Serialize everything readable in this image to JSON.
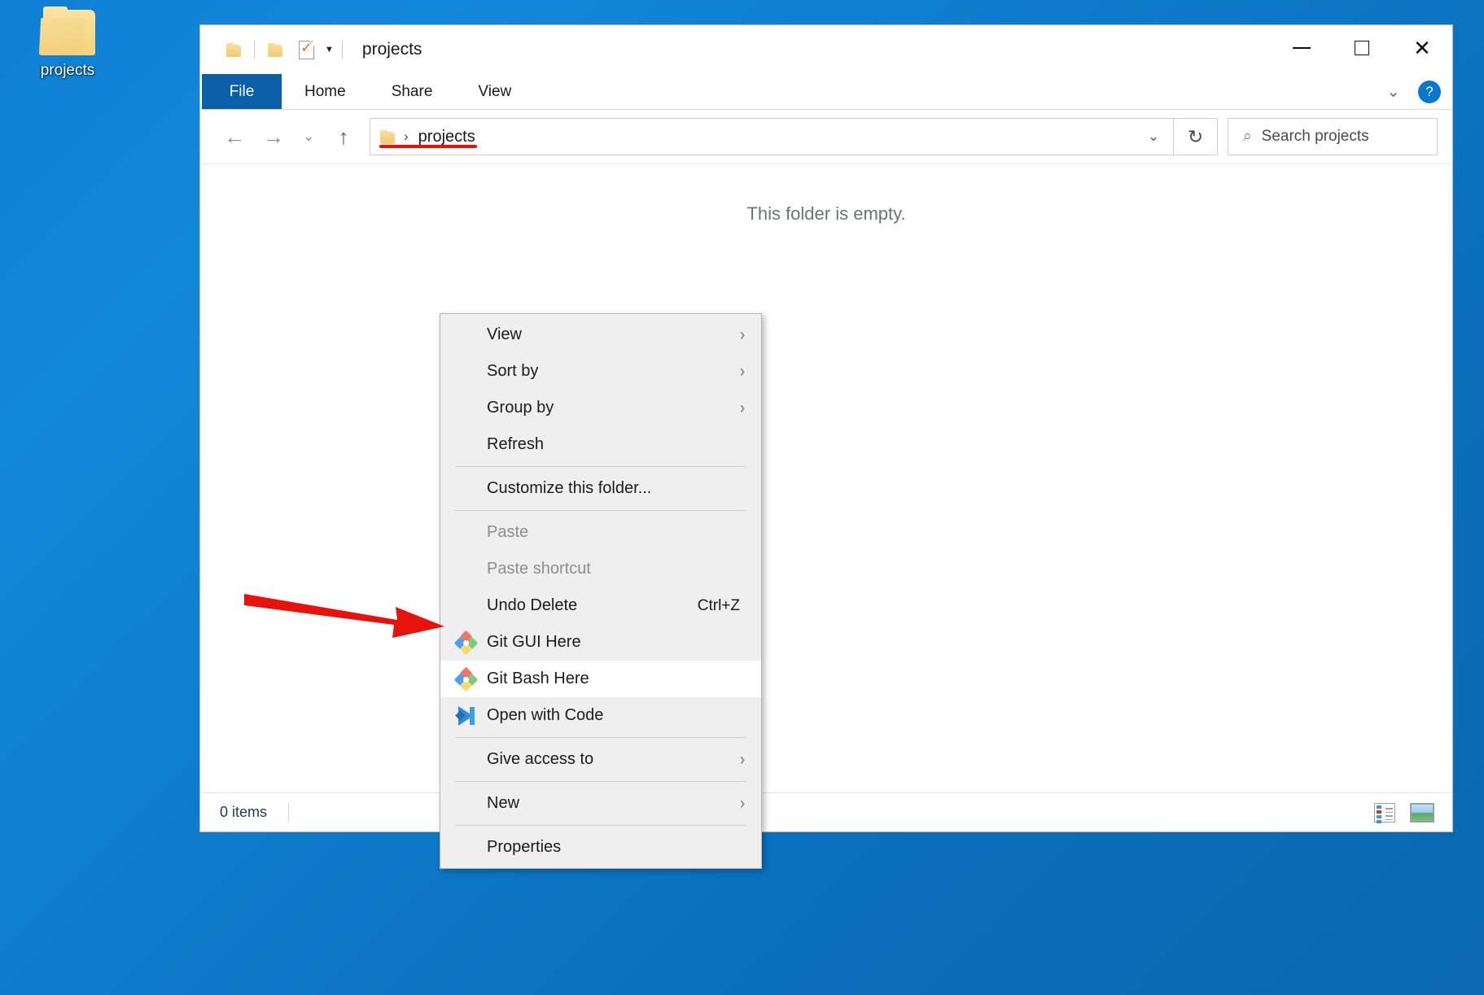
{
  "desktop": {
    "icon_label": "projects",
    "icon_name": "folder-icon"
  },
  "window": {
    "title": "projects",
    "quick_access": [
      "folder-icon",
      "folder-icon",
      "properties-checkbox-icon",
      "customize-caret-icon"
    ],
    "controls": {
      "minimize": "minimize-icon",
      "maximize": "maximize-icon",
      "close": "close-icon"
    },
    "ribbon": {
      "tabs": [
        "File",
        "Home",
        "Share",
        "View"
      ],
      "expand_label": "chevron-down-icon",
      "help_label": "?"
    },
    "address": {
      "back": "back-arrow-icon",
      "forward": "forward-arrow-icon",
      "recent": "recent-caret-icon",
      "up": "up-arrow-icon",
      "crumb": "projects",
      "separator": "›",
      "dropdown": "address-caret-icon",
      "refresh": "↻"
    },
    "search": {
      "placeholder": "Search projects",
      "icon": "search-icon"
    },
    "content": {
      "empty_message": "This folder is empty."
    },
    "status": {
      "count": "0 items",
      "view_details_icon": "details-view-icon",
      "view_thumbnails_icon": "thumbnail-view-icon"
    }
  },
  "context_menu": {
    "items": [
      {
        "label": "View",
        "type": "submenu",
        "icon": null,
        "accel": "",
        "state": "normal"
      },
      {
        "label": "Sort by",
        "type": "submenu",
        "icon": null,
        "accel": "",
        "state": "normal"
      },
      {
        "label": "Group by",
        "type": "submenu",
        "icon": null,
        "accel": "",
        "state": "normal"
      },
      {
        "label": "Refresh",
        "type": "item",
        "icon": null,
        "accel": "",
        "state": "normal"
      },
      {
        "label": "Customize this folder...",
        "type": "item",
        "icon": null,
        "accel": "",
        "state": "normal"
      },
      {
        "label": "Paste",
        "type": "item",
        "icon": null,
        "accel": "",
        "state": "disabled"
      },
      {
        "label": "Paste shortcut",
        "type": "item",
        "icon": null,
        "accel": "",
        "state": "disabled"
      },
      {
        "label": "Undo Delete",
        "type": "item",
        "icon": null,
        "accel": "Ctrl+Z",
        "state": "normal"
      },
      {
        "label": "Git GUI Here",
        "type": "item",
        "icon": "git-icon",
        "accel": "",
        "state": "normal"
      },
      {
        "label": "Git Bash Here",
        "type": "item",
        "icon": "git-icon",
        "accel": "",
        "state": "hover"
      },
      {
        "label": "Open with Code",
        "type": "item",
        "icon": "vscode-icon",
        "accel": "",
        "state": "normal"
      },
      {
        "label": "Give access to",
        "type": "submenu",
        "icon": null,
        "accel": "",
        "state": "normal"
      },
      {
        "label": "New",
        "type": "submenu",
        "icon": null,
        "accel": "",
        "state": "normal"
      },
      {
        "label": "Properties",
        "type": "item",
        "icon": null,
        "accel": "",
        "state": "normal"
      }
    ],
    "submenu_glyph": "›"
  },
  "annotations": {
    "arrow_color": "#e8120c",
    "arrow_target": "Git Bash Here",
    "underline_target": "projects"
  },
  "colors": {
    "accent_blue": "#0b5ea8",
    "desktop_blue": "#0d7ac9",
    "menu_bg": "#efefef",
    "annotation_red": "#e8120c"
  }
}
